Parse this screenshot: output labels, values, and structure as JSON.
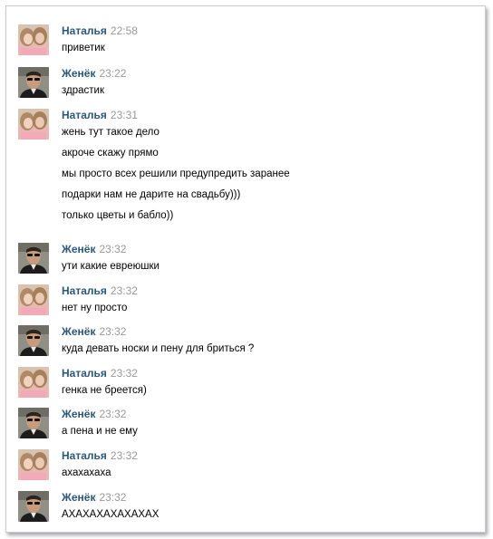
{
  "messages": [
    {
      "author": "Наталья",
      "time": "22:58",
      "avatar": "natalya-avatar",
      "lines": [
        "приветик"
      ]
    },
    {
      "author": "Женёк",
      "time": "23:22",
      "avatar": "zhenek-avatar",
      "lines": [
        "здрастик"
      ]
    },
    {
      "author": "Наталья",
      "time": "23:31",
      "avatar": "natalya-avatar",
      "lines": [
        "жень тут такое дело",
        "акроче скажу прямо",
        "мы просто всех решили предупредить заранее",
        "подарки нам не дарите на свадьбу)))",
        "только цветы и бабло))"
      ]
    },
    {
      "author": "Женёк",
      "time": "23:32",
      "avatar": "zhenek-avatar",
      "lines": [
        "ути какие евреюшки"
      ]
    },
    {
      "author": "Наталья",
      "time": "23:32",
      "avatar": "natalya-avatar",
      "lines": [
        "нет ну просто"
      ]
    },
    {
      "author": "Женёк",
      "time": "23:32",
      "avatar": "zhenek-avatar",
      "lines": [
        "куда девать носки и пену для бриться ?"
      ]
    },
    {
      "author": "Наталья",
      "time": "23:32",
      "avatar": "natalya-avatar",
      "lines": [
        "генка не бреется)"
      ]
    },
    {
      "author": "Женёк",
      "time": "23:32",
      "avatar": "zhenek-avatar",
      "lines": [
        "а пена и не ему"
      ]
    },
    {
      "author": "Наталья",
      "time": "23:32",
      "avatar": "natalya-avatar",
      "lines": [
        "ахахахаха"
      ]
    },
    {
      "author": "Женёк",
      "time": "23:32",
      "avatar": "zhenek-avatar",
      "lines": [
        "АХАХАХАХАХАХАХ"
      ]
    }
  ],
  "colors": {
    "author_name": "#2b587a",
    "timestamp": "#999999",
    "message_text": "#000000",
    "border": "#c9cdd2"
  }
}
